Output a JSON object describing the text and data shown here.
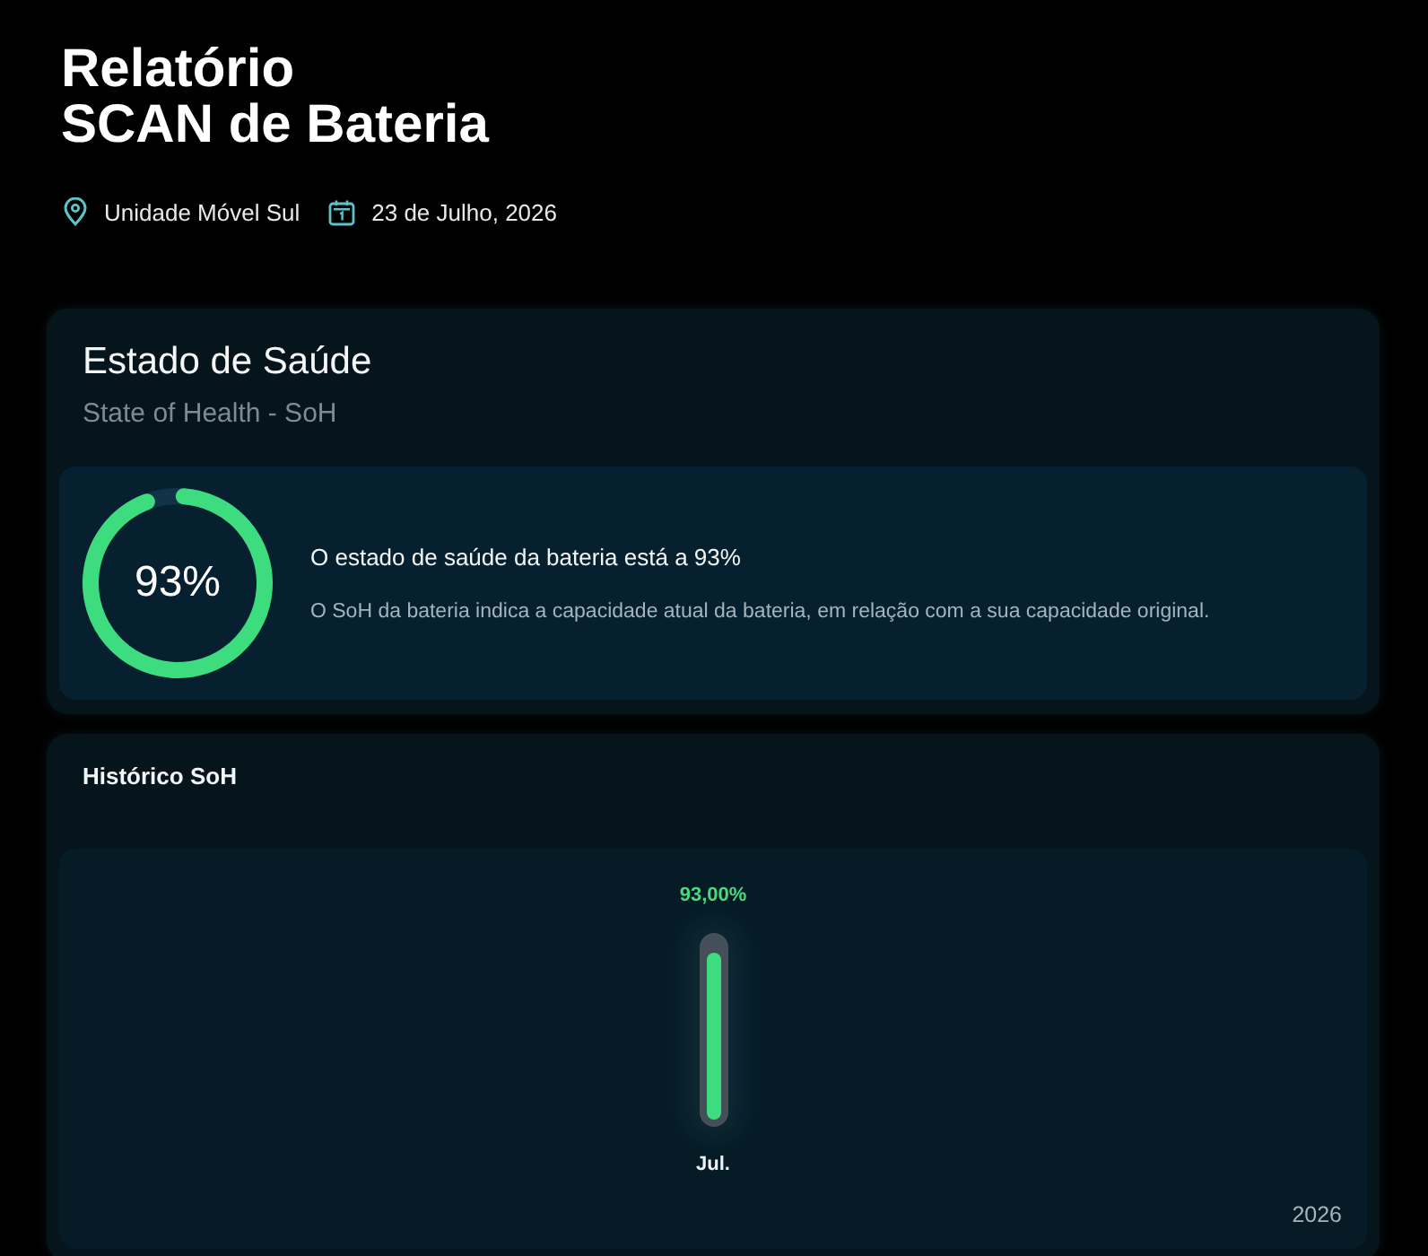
{
  "header": {
    "title_lines": [
      "Relatório",
      "SCAN de Bateria"
    ],
    "location": "Unidade Móvel Sul",
    "date": "23 de Julho, 2026"
  },
  "health_card": {
    "title": "Estado de Saúde",
    "subtitle": "State of Health - SoH",
    "gauge": {
      "level": 0.93,
      "reading": "93%"
    },
    "headline": "O estado de saúde da bateria está a 93%",
    "description": "O SoH da bateria indica a capacidade atual da bateria, em relação com a sua capacidade original."
  },
  "history_card": {
    "title": "Histórico SoH",
    "bars": [
      {
        "reading": "93,00%",
        "level": 0.93,
        "label": "Jul."
      }
    ],
    "year": "2026"
  }
}
